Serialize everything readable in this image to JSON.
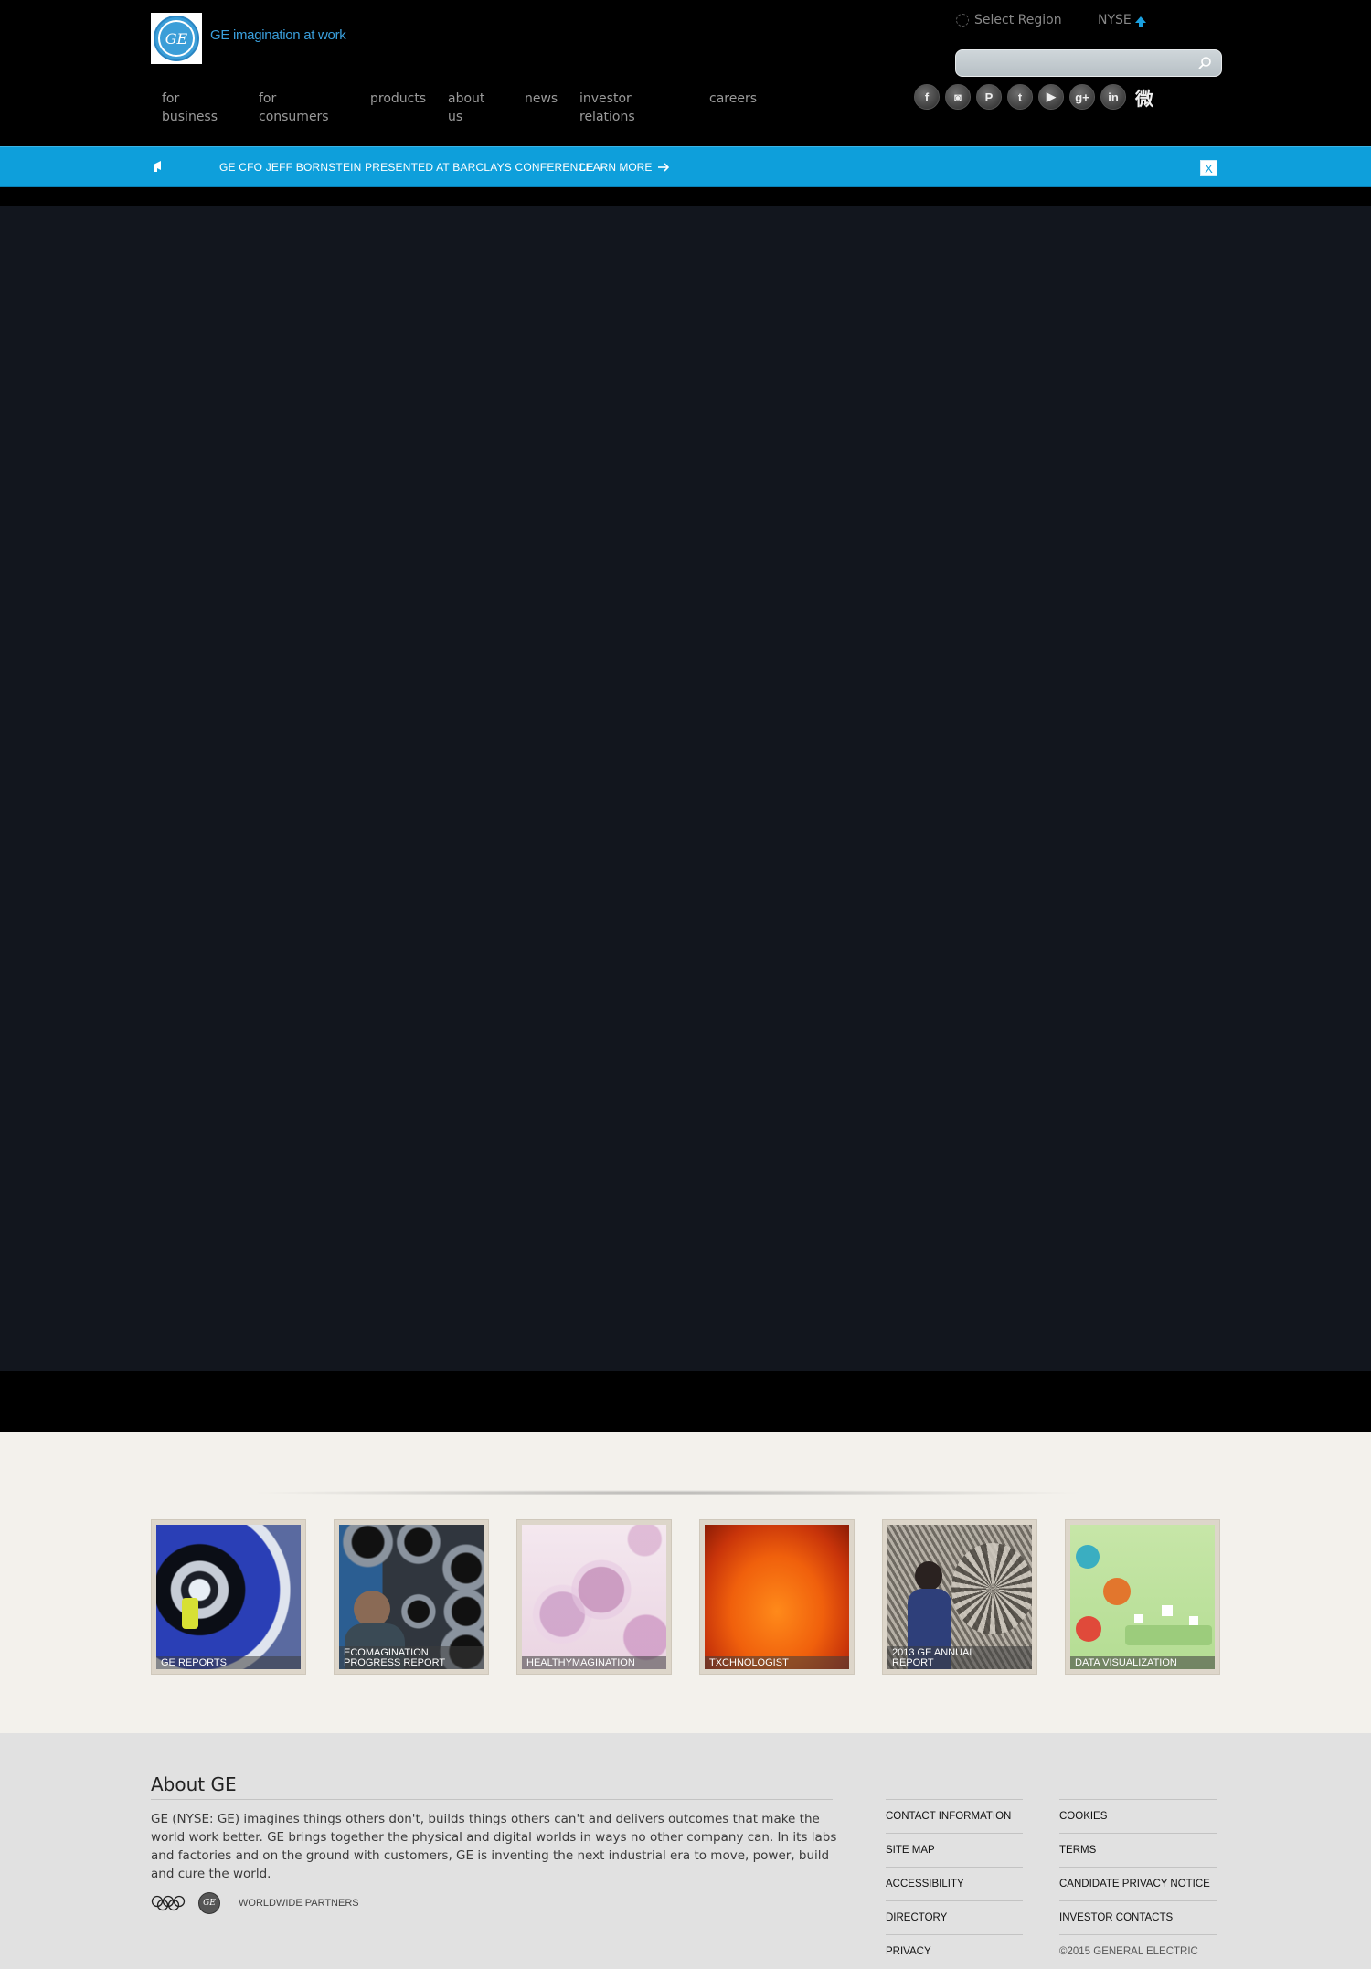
{
  "header": {
    "logo_text": "GE",
    "tagline": "GE imagination at work",
    "region_label": "Select Region",
    "stock_label": "NYSE",
    "search_placeholder": ""
  },
  "nav": [
    {
      "label": "for\nbusiness"
    },
    {
      "label": "for consumers"
    },
    {
      "label": "products"
    },
    {
      "label": "about\nus"
    },
    {
      "label": "news"
    },
    {
      "label": "investor\nrelations"
    },
    {
      "label": "careers"
    }
  ],
  "social": [
    {
      "icon": "facebook-icon",
      "glyph": "f"
    },
    {
      "icon": "instagram-icon",
      "glyph": "◙"
    },
    {
      "icon": "pinterest-icon",
      "glyph": "P"
    },
    {
      "icon": "twitter-icon",
      "glyph": "t"
    },
    {
      "icon": "youtube-icon",
      "glyph": "▶"
    },
    {
      "icon": "google-plus-icon",
      "glyph": "g+"
    },
    {
      "icon": "linkedin-icon",
      "glyph": "in"
    },
    {
      "icon": "weibo-icon",
      "glyph": "微"
    }
  ],
  "alert": {
    "text": "GE CFO JEFF BORNSTEIN PRESENTED AT BARCLAYS CONFERENCE –",
    "link_label": "LEARN MORE",
    "close_label": "X"
  },
  "tiles": [
    {
      "label": "GE REPORTS",
      "icon": "jet-engine-photo"
    },
    {
      "label": "ECOMAGINATION\nPROGRESS REPORT",
      "icon": "water-filters-photo"
    },
    {
      "label": "HEALTHYMAGINATION",
      "icon": "cells-photo"
    },
    {
      "label": "TXCHNOLOGIST",
      "icon": "sun-surface-photo"
    },
    {
      "label": "2013 GE ANNUAL\nREPORT",
      "icon": "turbine-worker-photo"
    },
    {
      "label": "DATA VISUALIZATION",
      "icon": "infographic-photo"
    }
  ],
  "footer": {
    "about_title": "About GE",
    "about_text": "GE (NYSE: GE) imagines things others don't, builds things others can't and delivers outcomes that make the world work better. GE brings together the physical and digital worlds in ways no other company can. In its labs and factories and on the ground with customers, GE is inventing the next industrial era to move, power, build and cure the world.",
    "partners_label": "WORLDWIDE PARTNERS",
    "links_col1": [
      "CONTACT INFORMATION",
      "SITE MAP",
      "ACCESSIBILITY",
      "DIRECTORY",
      "PRIVACY"
    ],
    "links_col2": [
      "COOKIES",
      "TERMS",
      "CANDIDATE PRIVACY NOTICE",
      "INVESTOR CONTACTS"
    ],
    "copyright": "©2015 GENERAL ELECTRIC"
  },
  "colors": {
    "brand_blue": "#3a9fdc",
    "alert_blue": "#0e9fdb",
    "hero_bg": "#12161e",
    "tiles_bg": "#f3f1ec",
    "footer_bg": "#e1e1e1"
  }
}
